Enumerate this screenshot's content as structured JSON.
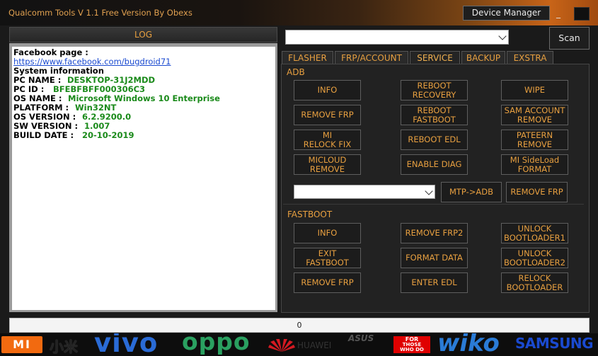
{
  "window": {
    "title": "Qualcomm Tools V 1.1 Free Version By Obexs",
    "device_manager_label": "Device Manager",
    "minimize_label": "_"
  },
  "log": {
    "header": "LOG",
    "facebook_label": "Facebook page :",
    "facebook_link": "https://www.facebook.com/bugdroid71",
    "system_info_label": "System information",
    "rows": [
      {
        "label": "PC NAME :",
        "value": "DESKTOP-31J2MDD"
      },
      {
        "label": "PC ID :",
        "value": "BFEBFBFF000306C3"
      },
      {
        "label": "OS NAME :",
        "value": "Microsoft Windows 10 Enterprise"
      },
      {
        "label": "PLATFORM :",
        "value": "Win32NT"
      },
      {
        "label": "OS VERSION :",
        "value": "6.2.9200.0"
      },
      {
        "label": "SW VERSION :",
        "value": "1.007"
      },
      {
        "label": "BUILD DATE :",
        "value": "20-10-2019"
      }
    ]
  },
  "toolbar": {
    "scan_label": "Scan"
  },
  "tabs": [
    "FLASHER",
    "FRP/ACCOUNT",
    "SERVICE",
    "BACKUP",
    "EXSTRA"
  ],
  "active_tab": "SERVICE",
  "adb": {
    "title": "ADB",
    "buttons": [
      "INFO",
      "REBOOT\nRECOVERY",
      "WIPE",
      "REMOVE FRP",
      "REBOOT\nFASTBOOT",
      "SAM ACCOUNT\nREMOVE",
      "MI\nRELOCK FIX",
      "REBOOT EDL",
      "PATEERN\nREMOVE",
      "MICLOUD\nREMOVE",
      "ENABLE DIAG",
      "MI SideLoad\nFORMAT"
    ],
    "mtp_label": "MTP->ADB",
    "remove_frp_label": "REMOVE FRP"
  },
  "fastboot": {
    "title": "FASTBOOT",
    "buttons": [
      "INFO",
      "REMOVE FRP2",
      "UNLOCK\nBOOTLOADER1",
      "EXIT\nFASTBOOT",
      "FORMAT DATA",
      "UNLOCK\nBOOTLOADER2",
      "REMOVE FRP",
      "ENTER EDL",
      "RELOCK\nBOOTLOADER"
    ]
  },
  "progress": {
    "value": "0"
  },
  "brands": {
    "mi": "MI",
    "xiaomi_cn": "小米",
    "vivo": "vivo",
    "oppo": "oppo",
    "huawei": "HUAWEI",
    "asus": "ASUS",
    "lenovo_for": "FOR",
    "lenovo_tag": "THOSE\nWHO DO",
    "wiko": "wiko",
    "samsung": "SAMSUNG"
  },
  "colors": {
    "accent": "#e8a040",
    "log_value": "#1a8a1a",
    "link": "#1a4ad0"
  }
}
